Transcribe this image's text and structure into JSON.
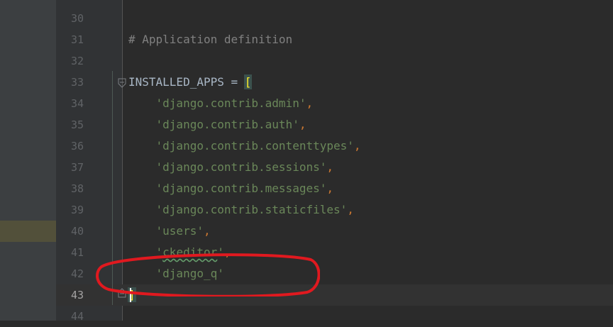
{
  "editor": {
    "lines": [
      {
        "num": "30",
        "tokens": []
      },
      {
        "num": "31",
        "tokens": [
          {
            "t": "comment",
            "v": "# Application definition"
          }
        ]
      },
      {
        "num": "32",
        "tokens": []
      },
      {
        "num": "33",
        "tokens": [
          {
            "t": "ident",
            "v": "INSTALLED_APPS"
          },
          {
            "t": "ident",
            "v": " = "
          },
          {
            "t": "bracket-hl",
            "v": "["
          }
        ]
      },
      {
        "num": "34",
        "tokens": [
          {
            "t": "str",
            "v": "    'django.contrib.admin'"
          },
          {
            "t": "punct",
            "v": ","
          }
        ]
      },
      {
        "num": "35",
        "tokens": [
          {
            "t": "str",
            "v": "    'django.contrib.auth'"
          },
          {
            "t": "punct",
            "v": ","
          }
        ]
      },
      {
        "num": "36",
        "tokens": [
          {
            "t": "str",
            "v": "    'django.contrib.contenttypes'"
          },
          {
            "t": "punct",
            "v": ","
          }
        ]
      },
      {
        "num": "37",
        "tokens": [
          {
            "t": "str",
            "v": "    'django.contrib.sessions'"
          },
          {
            "t": "punct",
            "v": ","
          }
        ]
      },
      {
        "num": "38",
        "tokens": [
          {
            "t": "str",
            "v": "    'django.contrib.messages'"
          },
          {
            "t": "punct",
            "v": ","
          }
        ]
      },
      {
        "num": "39",
        "tokens": [
          {
            "t": "str",
            "v": "    'django.contrib.staticfiles'"
          },
          {
            "t": "punct",
            "v": ","
          }
        ]
      },
      {
        "num": "40",
        "tokens": [
          {
            "t": "str",
            "v": "    'users'"
          },
          {
            "t": "punct",
            "v": ","
          }
        ]
      },
      {
        "num": "41",
        "tokens": [
          {
            "t": "str",
            "v": "    '"
          },
          {
            "t": "str typo",
            "v": "ckeditor"
          },
          {
            "t": "str",
            "v": "'"
          },
          {
            "t": "punct",
            "v": ","
          }
        ]
      },
      {
        "num": "42",
        "tokens": [
          {
            "t": "str",
            "v": "    'django_q'"
          }
        ]
      },
      {
        "num": "43",
        "tokens": [
          {
            "t": "bracket-hl",
            "v": "]"
          }
        ]
      },
      {
        "num": "44",
        "tokens": []
      }
    ],
    "current_line": "43"
  },
  "colors": {
    "background": "#2b2b2b",
    "comment": "#808080",
    "string": "#6a8759",
    "keyword_punct": "#cc7832",
    "identifier": "#a9b7c6",
    "bracket_match": "#ffef28",
    "annotation": "#e0191f"
  }
}
